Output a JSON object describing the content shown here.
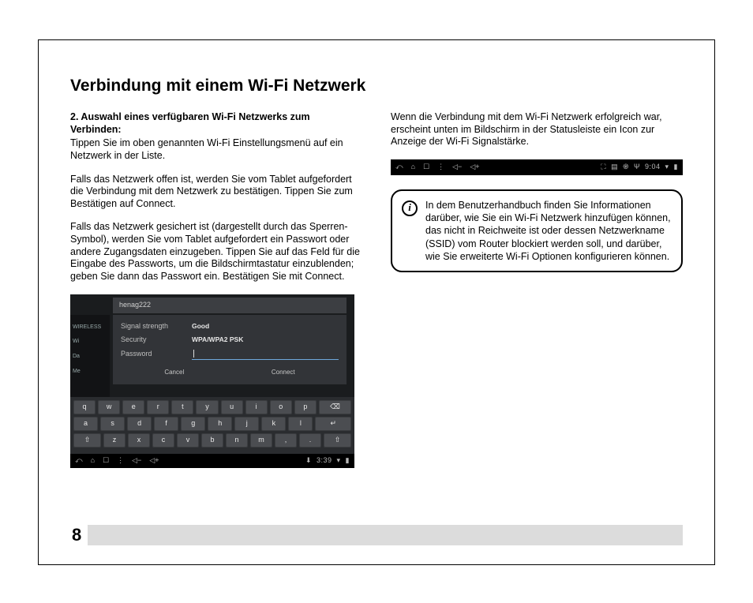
{
  "title": "Verbindung mit einem Wi-Fi Netzwerk",
  "page_number": "8",
  "left": {
    "subhead": "2. Auswahl eines verfügbaren Wi-Fi Netzwerks zum Verbinden:",
    "p1": "Tippen Sie im oben genannten Wi-Fi Einstellungsmenü auf ein Netzwerk in der Liste.",
    "p2": "Falls das Netzwerk offen ist, werden Sie vom Tablet aufgefordert die Verbindung mit dem Netzwerk zu bestätigen. Tippen Sie zum Bestätigen auf Connect.",
    "p3": "Falls das Netzwerk gesichert ist (dargestellt durch das Sperren-Symbol), werden Sie vom Tablet aufgefordert ein Passwort oder andere Zugangsdaten einzugeben. Tippen Sie auf das Feld für die Eingabe des Passworts, um die Bildschirmtastatur einzublenden; geben Sie dann das Passwort ein. Bestätigen Sie mit Connect."
  },
  "right": {
    "p1": "Wenn die Verbindung mit dem Wi-Fi Netzwerk erfolgreich war, erscheint unten im Bildschirm in der Statusleiste ein Icon zur Anzeige der Wi-Fi Signalstärke.",
    "info": "In dem Benutzerhandbuch finden Sie Informationen darüber, wie Sie ein Wi-Fi Netzwerk hinzufügen können, das nicht in Reichweite ist oder dessen Netzwerkname (SSID) vom Router blockiert werden soll, und darüber, wie Sie erweiterte Wi-Fi Optionen konfigurieren können."
  },
  "shot1": {
    "network_name": "henag222",
    "sidebar": {
      "wireless": "WIRELESS",
      "wifi": "Wi",
      "da": "Da",
      "me": "Me"
    },
    "rows": {
      "signal_label": "Signal strength",
      "signal_value": "Good",
      "security_label": "Security",
      "security_value": "WPA/WPA2 PSK",
      "password_label": "Password"
    },
    "buttons": {
      "cancel": "Cancel",
      "connect": "Connect"
    },
    "keyboard": {
      "r1": [
        "q",
        "w",
        "e",
        "r",
        "t",
        "y",
        "u",
        "i",
        "o",
        "p",
        "⌫"
      ],
      "r2": [
        "a",
        "s",
        "d",
        "f",
        "g",
        "h",
        "j",
        "k",
        "l",
        "↵"
      ],
      "r3": [
        "⇧",
        "z",
        "x",
        "c",
        "v",
        "b",
        "n",
        "m",
        ",",
        ".",
        "⇧"
      ]
    },
    "time": "3:39"
  },
  "shot2": {
    "time": "9:04"
  }
}
